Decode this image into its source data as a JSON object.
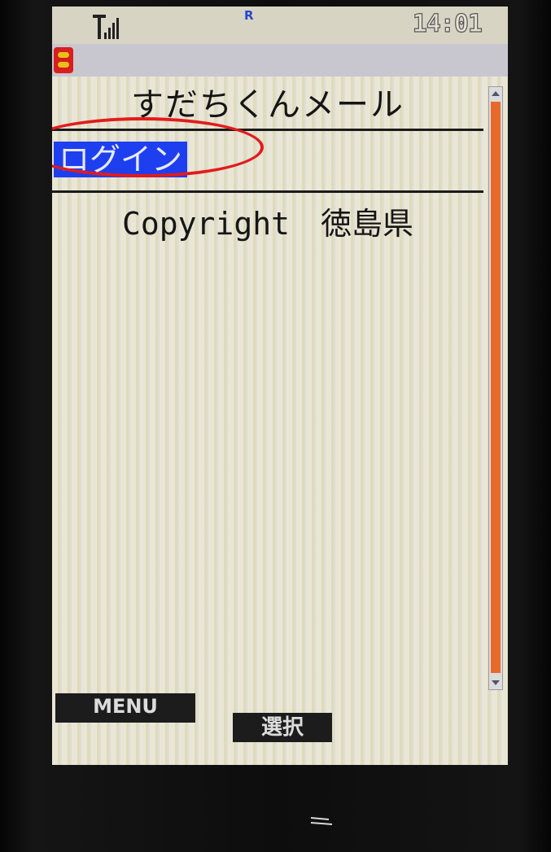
{
  "status_bar": {
    "roaming_indicator": "R",
    "clock": "14:01",
    "icons": [
      "signal-strength-icon"
    ]
  },
  "header": {
    "app_icon": "app-mail-icon"
  },
  "page": {
    "title": "すだちくんメール",
    "login_link": "ログイン",
    "copyright": "Copyright　徳島県"
  },
  "softkeys": {
    "left": "MENU",
    "center": "選択"
  },
  "colors": {
    "screen_background": "#e9e6d6",
    "link_highlight": "#1e3ff0",
    "annotation_circle": "#e31b1b",
    "scrollbar_thumb": "#e86a2a",
    "softkey_background": "#1c1c1c"
  },
  "scrollbar": {
    "position_fraction": 0.0,
    "visible_fraction": 1.0
  }
}
